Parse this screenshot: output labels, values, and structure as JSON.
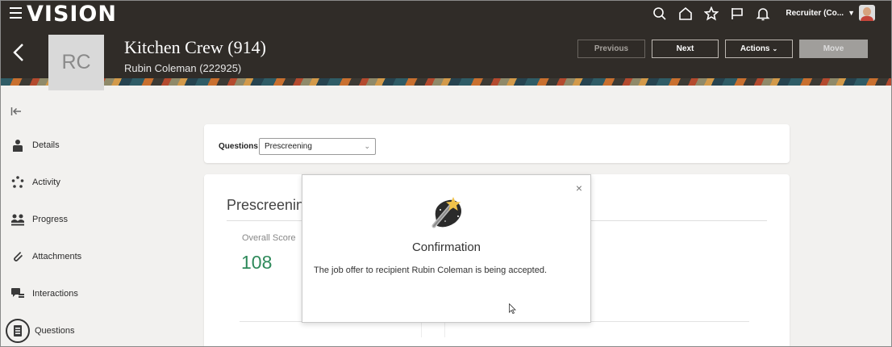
{
  "app": {
    "brand": "VISION"
  },
  "header": {
    "icons": [
      "search-icon",
      "home-icon",
      "star-icon",
      "flag-icon",
      "bell-icon"
    ],
    "user_label": "Recruiter (Co...",
    "avatar_initials": "RC",
    "job_title": "Kitchen Crew (914)",
    "candidate": "Rubin Coleman (222925)",
    "buttons": {
      "previous": "Previous",
      "next": "Next",
      "actions": "Actions",
      "move": "Move"
    }
  },
  "sidebar": {
    "items": [
      {
        "label": "Details",
        "icon": "person-icon"
      },
      {
        "label": "Activity",
        "icon": "activity-icon"
      },
      {
        "label": "Progress",
        "icon": "progress-icon"
      },
      {
        "label": "Attachments",
        "icon": "paperclip-icon"
      },
      {
        "label": "Interactions",
        "icon": "interactions-icon"
      },
      {
        "label": "Questions",
        "icon": "questions-icon"
      }
    ]
  },
  "questions": {
    "label": "Questions",
    "selected": "Prescreening"
  },
  "prescreening": {
    "heading": "Prescreening",
    "score_label": "Overall Score",
    "score_value": "108"
  },
  "dialog": {
    "title": "Confirmation",
    "message": "The job offer to recipient Rubin Coleman is being accepted.",
    "close": "×"
  },
  "colors": {
    "header_bg": "#302c28",
    "score_green": "#2f8a5b",
    "accent_gold": "#f0c24a"
  }
}
